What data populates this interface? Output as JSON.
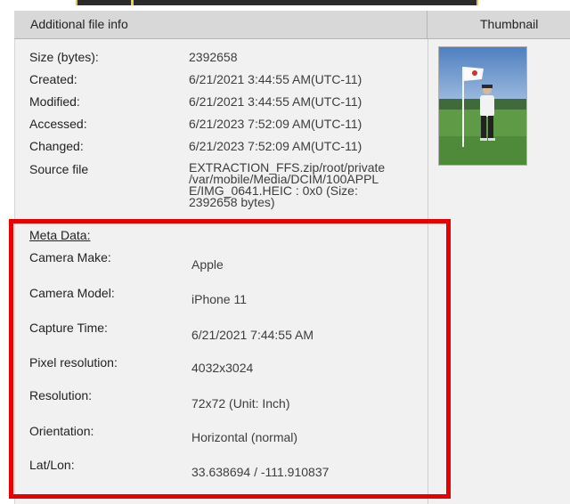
{
  "header": {
    "left_title": "Additional file info",
    "right_title": "Thumbnail"
  },
  "file_info": [
    {
      "label": "Size (bytes):",
      "value": "2392658"
    },
    {
      "label": "Created:",
      "value": "6/21/2021 3:44:55 AM(UTC-11)"
    },
    {
      "label": "Modified:",
      "value": "6/21/2021 3:44:55 AM(UTC-11)"
    },
    {
      "label": "Accessed:",
      "value": "6/21/2023 7:52:09 AM(UTC-11)"
    },
    {
      "label": "Changed:",
      "value": "6/21/2023 7:52:09 AM(UTC-11)"
    }
  ],
  "source_file": {
    "label": "Source file",
    "lines": [
      "EXTRACTION_FFS.zip/root/private",
      "/var/mobile/Media/DCIM/100APPL",
      "E/IMG_0641.HEIC : 0x0 (Size:",
      "2392658 bytes)"
    ]
  },
  "meta": {
    "title": "Meta Data:",
    "items": [
      {
        "label": "Camera Make:",
        "value": "Apple"
      },
      {
        "label": "Camera Model:",
        "value": "iPhone 11"
      },
      {
        "label": "Capture Time:",
        "value": "6/21/2021 7:44:55 AM"
      },
      {
        "label": "Pixel resolution:",
        "value": "4032x3024"
      },
      {
        "label": "Resolution:",
        "value": "72x72 (Unit: Inch)"
      },
      {
        "label": "Orientation:",
        "value": "Horizontal (normal)"
      },
      {
        "label": "Lat/Lon:",
        "value": "33.638694 / -111.910837"
      }
    ]
  },
  "colors": {
    "highlight": "#e80000",
    "header_bg": "#d8d8d8",
    "panel_bg": "#f1f1f1"
  }
}
